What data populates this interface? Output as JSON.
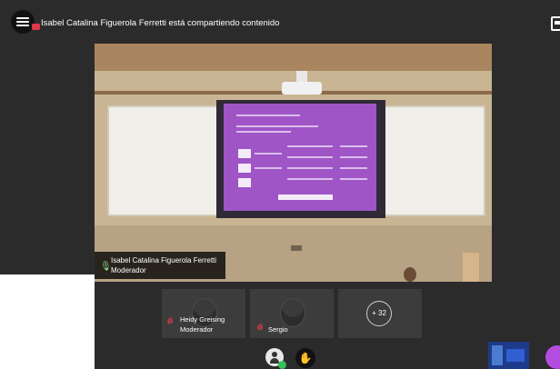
{
  "header": {
    "share_text": "Isabel Catalina Figuerola Ferretti está compartiendo contenido"
  },
  "speaker": {
    "name": "Isabel Catalina Figuerola Ferretti",
    "role": "Moderador"
  },
  "participants": [
    {
      "name": "Heidy Greising",
      "role": "Moderador",
      "muted": true
    },
    {
      "name": "Sergio",
      "role": "",
      "muted": true
    }
  ],
  "overflow_count": "+ 32",
  "icons": {
    "menu": "hamburger-menu-icon",
    "share": "screen-share-icon",
    "mic_on": "microphone-icon",
    "mic_off": "microphone-muted-icon",
    "self": "user-avatar-icon",
    "hand": "raise-hand-icon",
    "layout": "layout-icon"
  },
  "colors": {
    "background": "#2b2b2b",
    "muted": "#e0364a",
    "mic_active": "#8fe18f",
    "presenting": "#9f55c6",
    "accent": "#b34de0"
  }
}
